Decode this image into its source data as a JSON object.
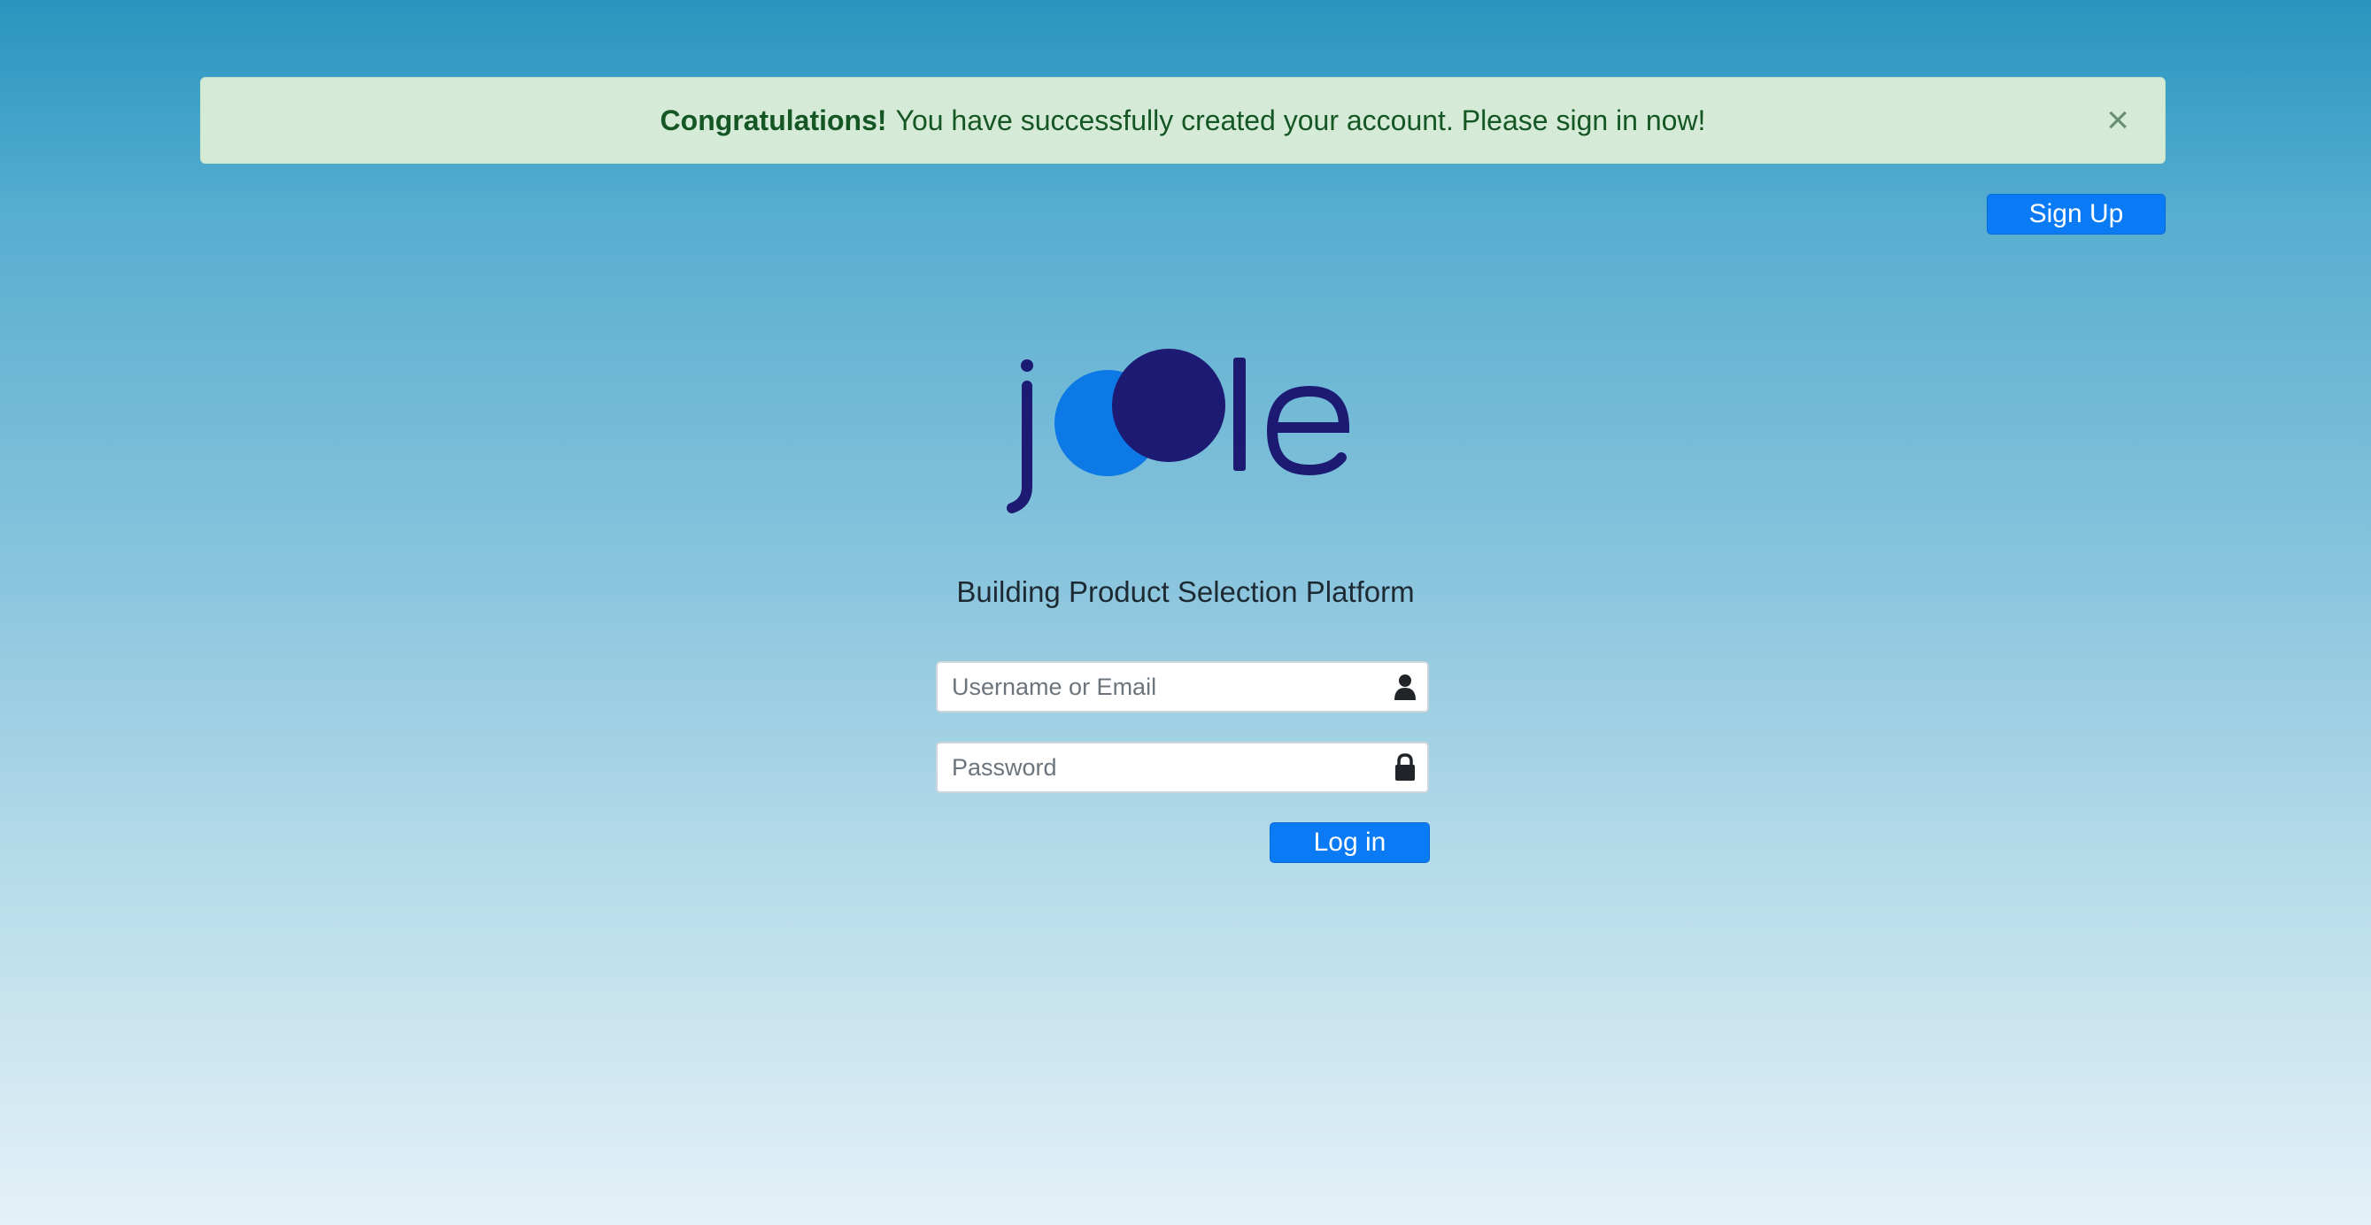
{
  "alert": {
    "strong": "Congratulations!",
    "message": "You have successfully created your account. Please sign in now!",
    "close_symbol": "×"
  },
  "header": {
    "signup_label": "Sign Up"
  },
  "logo": {
    "text": "joole",
    "colors": {
      "dark": "#1c1a73",
      "light": "#0c79e6"
    }
  },
  "subtitle": "Building Product Selection Platform",
  "form": {
    "username_placeholder": "Username or Email",
    "username_icon": "user-icon",
    "password_placeholder": "Password",
    "password_icon": "lock-icon",
    "login_label": "Log in"
  },
  "colors": {
    "primary_button": "#0a7bf5",
    "alert_bg": "#d5ebd8",
    "alert_text": "#155724"
  }
}
